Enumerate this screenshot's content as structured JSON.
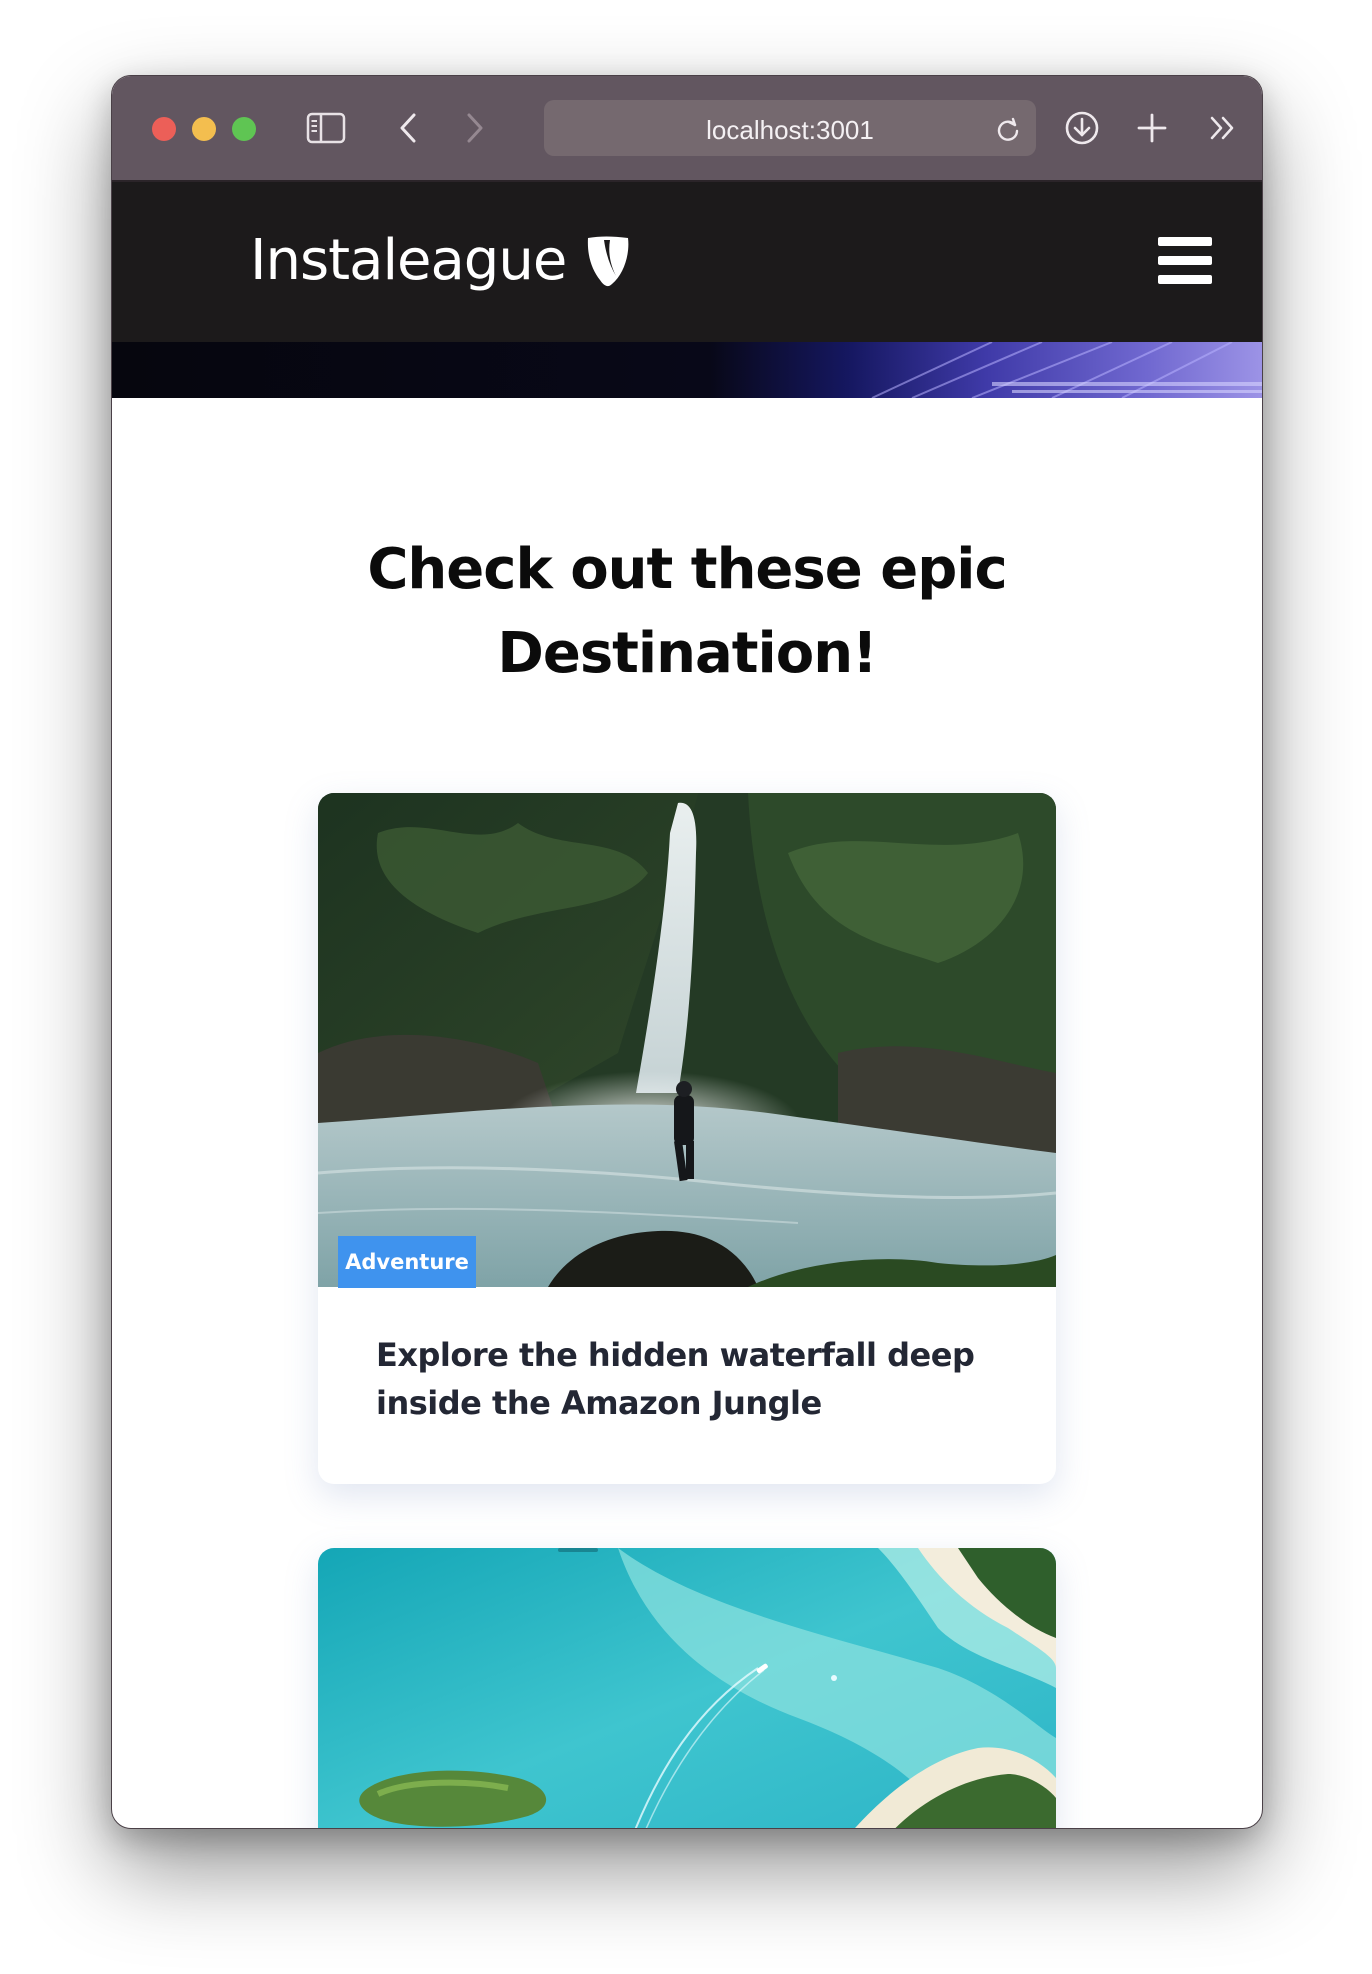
{
  "browser": {
    "url": "localhost:3001",
    "icons": {
      "close": "close-window-dot",
      "minimize": "minimize-window-dot",
      "zoom": "zoom-window-dot",
      "sidebar": "sidebar-toggle-icon",
      "back": "back-arrow-icon",
      "forward": "forward-arrow-icon",
      "reload": "reload-icon",
      "downloads": "download-icon",
      "new_tab": "plus-icon",
      "more": "double-chevron-right-icon"
    },
    "colors": {
      "close": "#ec5f58",
      "minimize": "#f3be4f",
      "zoom": "#5fc553"
    }
  },
  "site": {
    "logo_text": "Instaleague",
    "logo_icon": "typo3-logo-icon",
    "menu_icon": "hamburger-menu-icon"
  },
  "main": {
    "heading_line1": "Check out these epic",
    "heading_line2": "Destination!",
    "cards": [
      {
        "tag": "Adventure",
        "title": "Explore the hidden waterfall deep inside the Amazon Jungle",
        "image": "waterfall-photo",
        "tag_color": "#3f93ee"
      },
      {
        "image": "aerial-beach-lagoon-photo"
      }
    ]
  }
}
